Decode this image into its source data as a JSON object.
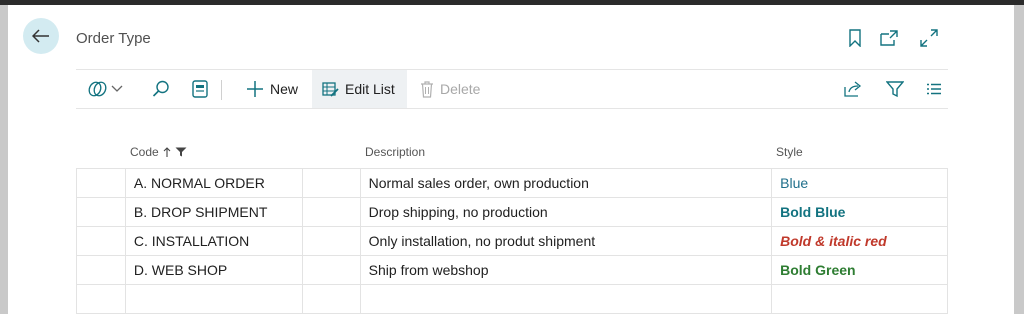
{
  "page": {
    "title": "Order Type"
  },
  "actions": {
    "new_label": "New",
    "edit_list_label": "Edit List",
    "delete_label": "Delete"
  },
  "columns": {
    "code": "Code",
    "description": "Description",
    "style": "Style"
  },
  "rows": [
    {
      "code": "A. NORMAL ORDER",
      "description": "Normal sales order, own production",
      "style": "Blue"
    },
    {
      "code": "B. DROP SHIPMENT",
      "description": "Drop shipping, no production",
      "style": "Bold Blue"
    },
    {
      "code": "C. INSTALLATION",
      "description": "Only installation, no produt shipment",
      "style": "Bold & italic red"
    },
    {
      "code": "D. WEB SHOP",
      "description": "Ship from webshop",
      "style": "Bold Green"
    }
  ],
  "icons": {
    "back": "arrow-left-icon",
    "bookmark": "bookmark-icon",
    "open_new": "open-in-new-window-icon",
    "expand": "expand-icon",
    "copilot": "copilot-icon",
    "search": "search-icon",
    "layout": "page-layout-icon",
    "new": "plus-icon",
    "edit_list": "edit-list-icon",
    "delete": "trash-icon",
    "share": "share-icon",
    "filter": "filter-icon",
    "list": "list-view-icon",
    "sort": "sort-ascending-icon",
    "column_filter": "filter-active-icon"
  },
  "colors": {
    "accent": "#137380",
    "back_button_bg": "#d3ebf1",
    "style_blue": "#1f6f8b",
    "style_red": "#c0392b",
    "style_green": "#2e7d32"
  }
}
